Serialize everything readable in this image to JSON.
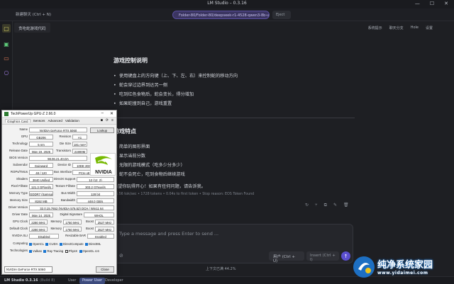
{
  "window": {
    "title": "LM Studio – 0.3.16",
    "min": "—",
    "max": "☐",
    "close": "✕"
  },
  "toolbar": {
    "new_chat": "新建聊天 (Ctrl + N)",
    "model_path": "Folder-80/Folder-80/deepseek-r1-4528-qwen3-8b-ud_k_m.gguf",
    "eject": "Eject"
  },
  "sidebar": {
    "icons": [
      "chat-icon",
      "terminal-icon",
      "folder-icon",
      "search-icon"
    ]
  },
  "tab": {
    "label": "贪吃蛇游戏代码"
  },
  "header_actions": [
    "系统提示",
    "聊天分支",
    "Hole",
    "设置"
  ],
  "chat": {
    "section1_title": "游戏控制说明",
    "controls": [
      "使用键盘上的方向键（上、下、左、右）来控制蛇的移动方向",
      "蛇会穿过边界到达另一侧",
      "吃到红色食物后，蛇会变长，得分增加",
      "如果蛇撞到自己，游戏重置"
    ],
    "section2_title": "游戏特点",
    "features": [
      "1. 简单的图形界面",
      "2. 显示当前分数",
      "3. 无限的游戏模式（吃多少分多少）",
      "4. 蛇不会死亡，吃到食物后继续游戏"
    ],
    "closing": "希望你玩得开心！如果有任何问题，请告诉我。",
    "meta": "66.56 tok/sec • 1728 tokens • 0.04s to first token • Stop reason: EOS Token Found"
  },
  "composer": {
    "placeholder": "Type a message and press Enter to send ...",
    "user_label": "用户 (Ctrl + U)",
    "insert_label": "Insert (Ctrl + I)",
    "context": "上下文已满 44.2%"
  },
  "status": {
    "app": "LM Studio 0.3.16",
    "build": "(Build 8)",
    "modes": [
      "User",
      "Power User",
      "Developer"
    ]
  },
  "gpuz": {
    "title": "TechPowerUp GPU-Z 2.66.0",
    "tabs": [
      "Graphics Card",
      "Sensors",
      "Advanced",
      "Validation"
    ],
    "rows": {
      "name": "NVIDIA GeForce RTX 5060",
      "lookup": "Lookup",
      "gpu": "GB206",
      "revision": "A1",
      "technology": "5 nm",
      "die_size": "181 mm²",
      "release_date": "May 19, 2025",
      "transistors": "21900M",
      "bios": "98.06.21.40.DA",
      "uefi": "UEFI",
      "subvendor": "Gainward",
      "device_id": "10DE 2D05 - 10B0 2061",
      "rops_tmus": "48 / 120",
      "bus_interface": "PCIe x8 5.0 @ x8 5.0",
      "shaders": "3840 Unified",
      "directx": "12 (12_2)",
      "pixel_fillrate": "121.3 GPixel/s",
      "texture_fillrate": "303.2 GTexel/s",
      "memory_type": "GDDR7 (Samsung)",
      "bus_width": "128 bit",
      "memory_size": "8192 MB",
      "bandwidth": "448.0 GB/s",
      "driver_version": "32.0.15.7652 (NVIDIA 576.52) DCH / Win11 64",
      "driver_date": "May 14, 2025",
      "digital_signature": "WHQL",
      "gpu_clock": "2280 MHz",
      "mem_clock": "1750 MHz",
      "boost": "2527 MHz",
      "def_gpu_clock": "2280 MHz",
      "def_mem_clock": "1750 MHz",
      "def_boost": "2527 MHz",
      "nvidia_sli": "Disabled",
      "resizable_bar": "Enabled"
    },
    "labels": {
      "name": "Name",
      "gpu": "GPU",
      "revision": "Revision",
      "technology": "Technology",
      "die_size": "Die Size",
      "release_date": "Release Date",
      "transistors": "Transistors",
      "bios": "BIOS Version",
      "subvendor": "Subvendor",
      "device_id": "Device ID",
      "rops": "ROPs/TMUs",
      "bus": "Bus Interface",
      "shaders": "Shaders",
      "directx": "DirectX Support",
      "pixel": "Pixel Fillrate",
      "texture": "Texture Fillrate",
      "memtype": "Memory Type",
      "buswidth": "Bus Width",
      "memsize": "Memory Size",
      "bandwidth": "Bandwidth",
      "driver": "Driver Version",
      "driverdate": "Driver Date",
      "sig": "Digital Signature",
      "gpuclock": "GPU Clock",
      "memory": "Memory",
      "boost": "Boost",
      "defclock": "Default Clock",
      "sli": "NVIDIA SLI",
      "rbar": "Resizable BAR",
      "computing": "Computing",
      "technologies": "Technologies"
    },
    "computing": [
      "OpenCL",
      "CUDA",
      "DirectCompute",
      "DirectML"
    ],
    "technologies": [
      "Vulkan",
      "Ray Tracing",
      "PhysX",
      "OpenGL 4.6"
    ],
    "device_select": "NVIDIA GeForce RTX 5060",
    "close": "Close"
  },
  "watermark": {
    "line1": "纯净系统家园",
    "line2": "www.yidaimei.com"
  }
}
